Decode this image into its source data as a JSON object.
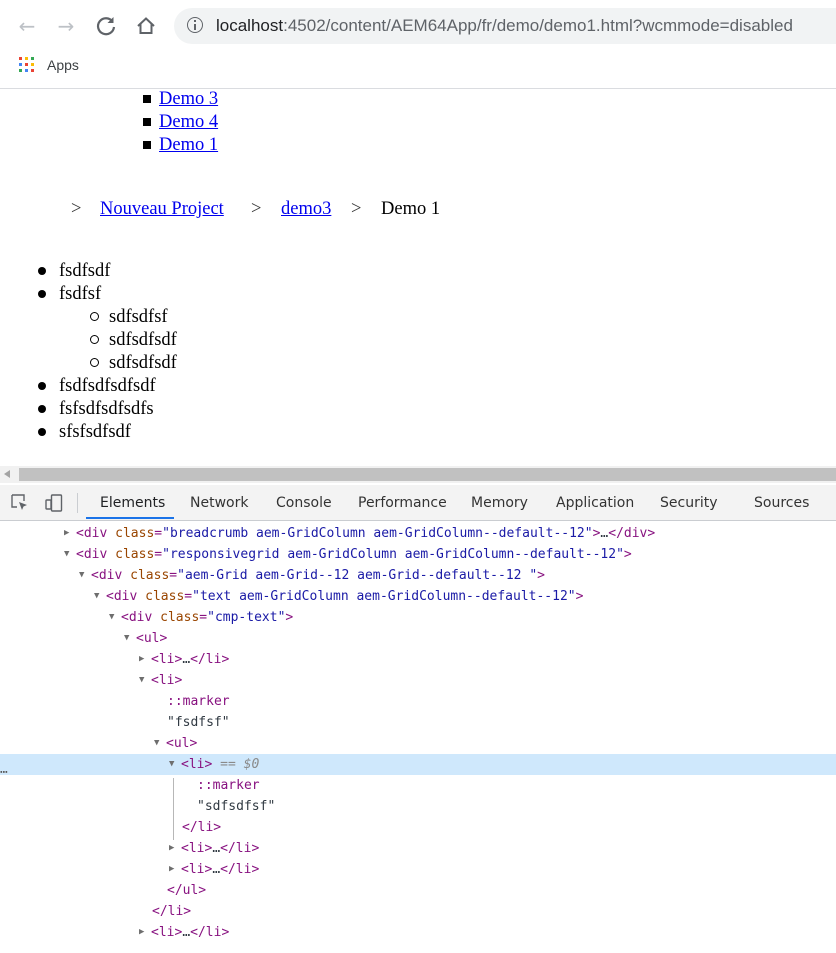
{
  "browser": {
    "url_prefix": "localhost",
    "url_rest": ":4502/content/AEM64App/fr/demo/demo1.html?wcmmode=disabled",
    "bookmarks_apps_label": "Apps",
    "apps_icon_colors": [
      "#ea4335",
      "#fbbc05",
      "#34a853",
      "#4285f4",
      "#ea4335",
      "#fbbc05",
      "#34a853",
      "#4285f4",
      "#ea4335"
    ]
  },
  "page": {
    "nav_links": [
      "Demo 3",
      "Demo 4",
      "Demo 1"
    ],
    "breadcrumb": {
      "separator": ">",
      "links": [
        "Nouveau Project",
        "demo3"
      ],
      "current": "Demo 1"
    },
    "text_list": {
      "item1": "fsdfsdf",
      "item2": "fsdfsf",
      "sub_items": [
        "sdfsdfsf",
        "sdfsdfsdf",
        "sdfsdfsdf"
      ],
      "item3": "fsdfsdfsdfsdf",
      "item4": "fsfsdfsdfsdfs",
      "item5": "sfsfsdfsdf"
    }
  },
  "devtools": {
    "tabs": [
      "Elements",
      "Network",
      "Console",
      "Performance",
      "Memory",
      "Application",
      "Security",
      "Sources"
    ],
    "active_tab": "Elements",
    "selected_suffix": "== $0",
    "dom": {
      "r1_class": "breadcrumb aem-GridColumn aem-GridColumn--default--12",
      "r2_class": "responsivegrid aem-GridColumn aem-GridColumn--default--12",
      "r3_class": "aem-Grid aem-Grid--12 aem-Grid--default--12 ",
      "r4_class": "text aem-GridColumn aem-GridColumn--default--12",
      "r5_class": "cmp-text",
      "marker": "::marker",
      "text_fsdfsf": "\"fsdfsf\"",
      "text_sdfsdfsf": "\"sdfsdfsf\"",
      "ellipsis": "…"
    }
  }
}
